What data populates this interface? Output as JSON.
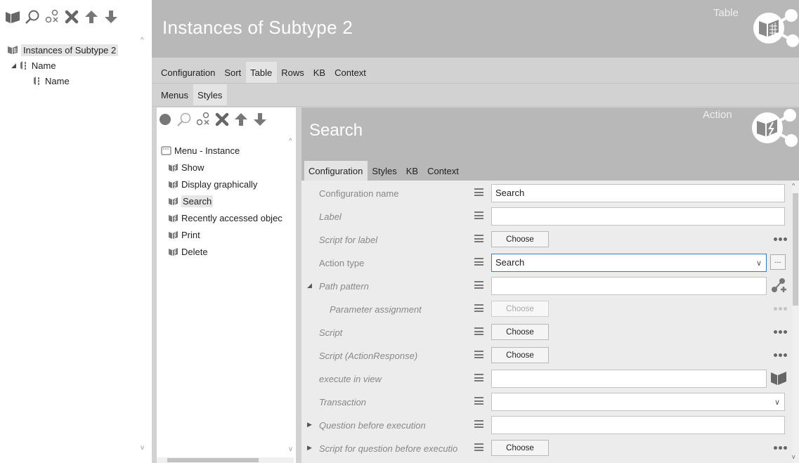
{
  "left_panel": {
    "toolbar_icons": [
      "folder-icon",
      "search-icon",
      "link-icon",
      "delete-icon",
      "arrow-up-icon",
      "arrow-down-icon"
    ],
    "tree": [
      {
        "label": "Instances of Subtype 2",
        "icon": "table-icon",
        "selected": true
      },
      {
        "label": "Name",
        "icon": "attribute-icon",
        "expanded": true
      },
      {
        "label": "Name",
        "icon": "attribute-icon"
      }
    ]
  },
  "main": {
    "title": "Instances of Subtype 2",
    "type_label": "Table",
    "tabs": [
      {
        "label": "Configuration"
      },
      {
        "label": "Sort"
      },
      {
        "label": "Table",
        "active": true
      },
      {
        "label": "Rows"
      },
      {
        "label": "KB"
      },
      {
        "label": "Context"
      }
    ],
    "subtabs": [
      {
        "label": "Menus"
      },
      {
        "label": "Styles",
        "active": true
      }
    ]
  },
  "menu_panel": {
    "toolbar_icons": [
      "circle-icon",
      "search-icon",
      "link-icon",
      "delete-icon",
      "arrow-up-icon",
      "arrow-down-icon"
    ],
    "root": "Menu - Instance",
    "items": [
      {
        "label": "Show"
      },
      {
        "label": "Display graphically"
      },
      {
        "label": "Search",
        "selected": true
      },
      {
        "label": "Recently accessed objec"
      },
      {
        "label": "Print"
      },
      {
        "label": "Delete"
      }
    ]
  },
  "action": {
    "title": "Search",
    "type_label": "Action",
    "tabs": [
      {
        "label": "Configuration",
        "active": true
      },
      {
        "label": "Styles"
      },
      {
        "label": "KB"
      },
      {
        "label": "Context"
      }
    ],
    "rows": [
      {
        "label": "Configuration name",
        "kind": "input",
        "value": "Search"
      },
      {
        "label": "Label",
        "kind": "input",
        "value": ""
      },
      {
        "label": "Script for label",
        "kind": "button",
        "button_label": "Choose"
      },
      {
        "label": "Action type",
        "kind": "select",
        "value": "Search"
      },
      {
        "label": "Path pattern",
        "kind": "input-path",
        "value": ""
      },
      {
        "label": "Parameter assignment",
        "kind": "button-disabled",
        "button_label": "Choose"
      },
      {
        "label": "Script",
        "kind": "button",
        "button_label": "Choose"
      },
      {
        "label": "Script (ActionResponse)",
        "kind": "button",
        "button_label": "Choose"
      },
      {
        "label": "execute in view",
        "kind": "input-view",
        "value": ""
      },
      {
        "label": "Transaction",
        "kind": "select-plain",
        "value": ""
      },
      {
        "label": "Question before execution",
        "kind": "input",
        "value": ""
      },
      {
        "label": "Script for question before executio",
        "kind": "button",
        "button_label": "Choose"
      }
    ],
    "ellipsis_label": "..."
  },
  "colors": {
    "header_gray": "#b8b8b8",
    "panel_gray": "#d2d2d2",
    "form_bg": "#ececec",
    "focus_blue": "#2f7fd4"
  }
}
